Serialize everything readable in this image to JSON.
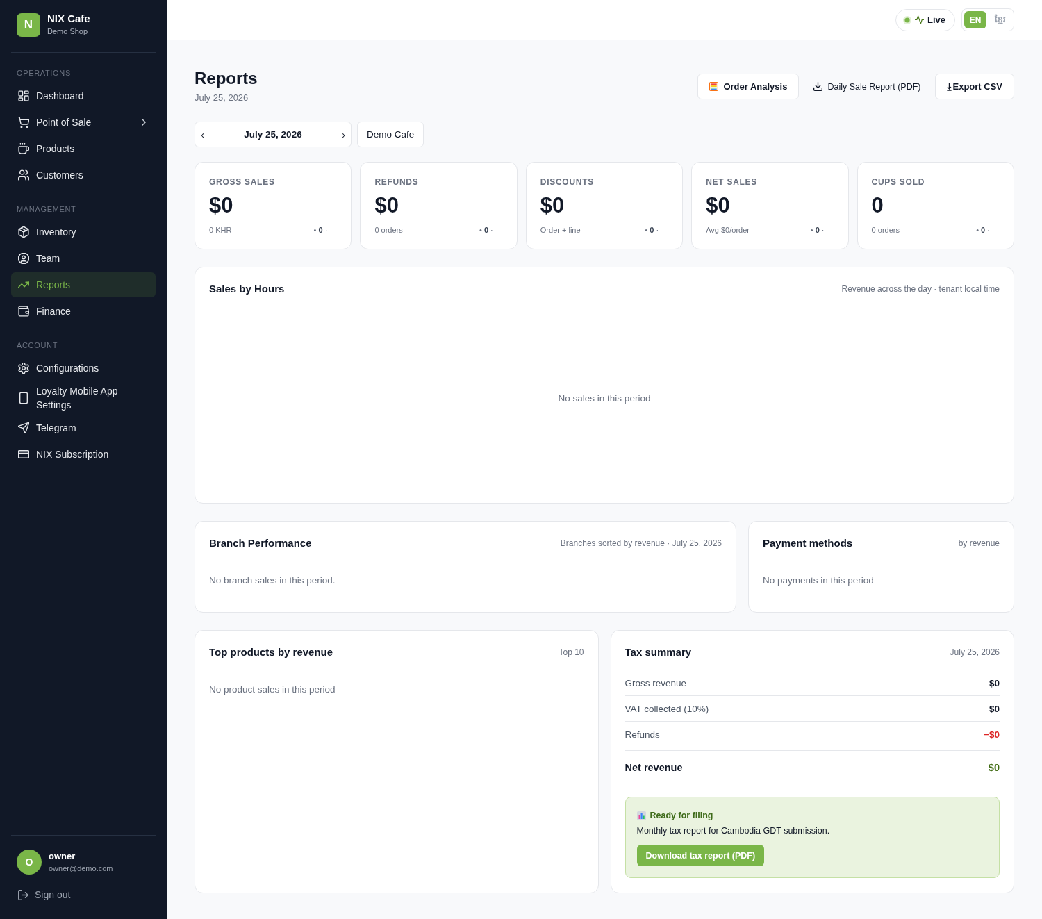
{
  "sidebar": {
    "brand": {
      "logo": "N",
      "name": "NIX Cafe",
      "subtitle": "Demo Shop"
    },
    "sections": [
      {
        "title": "OPERATIONS",
        "items": [
          {
            "label": "Dashboard",
            "selected": false
          },
          {
            "label": "Point of Sale",
            "selected": false,
            "expanded": false
          },
          {
            "label": "Products",
            "selected": false
          },
          {
            "label": "Customers",
            "selected": false
          }
        ]
      },
      {
        "title": "MANAGEMENT",
        "items": [
          {
            "label": "Inventory",
            "selected": false
          },
          {
            "label": "Team",
            "selected": false
          },
          {
            "label": "Reports",
            "selected": true
          },
          {
            "label": "Finance",
            "selected": false
          }
        ]
      },
      {
        "title": "ACCOUNT",
        "items": [
          {
            "label": "Configurations",
            "selected": false
          },
          {
            "label": "Loyalty Mobile App Settings",
            "selected": false
          },
          {
            "label": "Telegram",
            "selected": false
          },
          {
            "label": "NIX Subscription",
            "selected": false
          }
        ]
      }
    ],
    "user": {
      "avatar": "O",
      "name": "owner",
      "email": "owner@demo.com"
    },
    "sign_out": "Sign out"
  },
  "top_bar": {
    "live": {
      "label": "Live",
      "on": true
    },
    "languages": [
      {
        "label": "EN",
        "selected": true
      },
      {
        "label": "ខ្មែរ",
        "selected": false
      }
    ]
  },
  "page": {
    "title": "Reports",
    "date": "July 25, 2026",
    "actions": [
      {
        "label": "Order Analysis",
        "kind": "outlined"
      },
      {
        "label": "Daily Sale Report (PDF)",
        "kind": "plain"
      },
      {
        "label": "Export CSV",
        "kind": "outlined"
      }
    ]
  },
  "filters": {
    "date": {
      "prev": "‹",
      "value": "July 25, 2026",
      "next": "›"
    },
    "branch": "Demo Cafe"
  },
  "kpis": [
    {
      "label": "GROSS SALES",
      "value": "$0",
      "sub": "0 KHR",
      "trend": "• **0** · —"
    },
    {
      "label": "REFUNDS",
      "value": "$0",
      "sub": "0 orders",
      "trend": "• **0** · —"
    },
    {
      "label": "DISCOUNTS",
      "value": "$0",
      "sub": "Order + line",
      "trend": "• **0** · —"
    },
    {
      "label": "NET SALES",
      "value": "$0",
      "sub": "Avg $0/order",
      "trend": "• **0** · —"
    },
    {
      "label": "CUPS SOLD",
      "value": "0",
      "sub": "0 orders",
      "trend": "• **0** · —"
    }
  ],
  "sales_by_hours": {
    "title": "Sales by Hours",
    "subtitle": "Revenue across the day · tenant local time",
    "empty_message": "No sales in this period"
  },
  "branch_performance": {
    "title": "Branch Performance",
    "subtitle": "Branches sorted by revenue · July 25, 2026",
    "empty_message": "No branch sales in this period."
  },
  "payment_methods": {
    "title": "Payment methods",
    "subtitle": "by revenue",
    "empty_message": "No payments in this period"
  },
  "top_products": {
    "title": "Top products by revenue",
    "subtitle": "Top 10",
    "empty_message": "No product sales in this period"
  },
  "tax_summary": {
    "title": "Tax summary",
    "date": "July 25, 2026",
    "rows": [
      {
        "label": "Gross revenue",
        "value": "$0",
        "kind": "line"
      },
      {
        "label": "VAT collected (10%)",
        "value": "$0",
        "kind": "line"
      },
      {
        "label": "Refunds",
        "value": "−$0",
        "kind": "deduction"
      },
      {
        "label": "Net revenue",
        "value": "$0",
        "kind": "total"
      }
    ],
    "filing": {
      "title": "Ready for filing",
      "text": "Monthly tax report for Cambodia GDT submission.",
      "button": "Download tax report (PDF)"
    }
  }
}
